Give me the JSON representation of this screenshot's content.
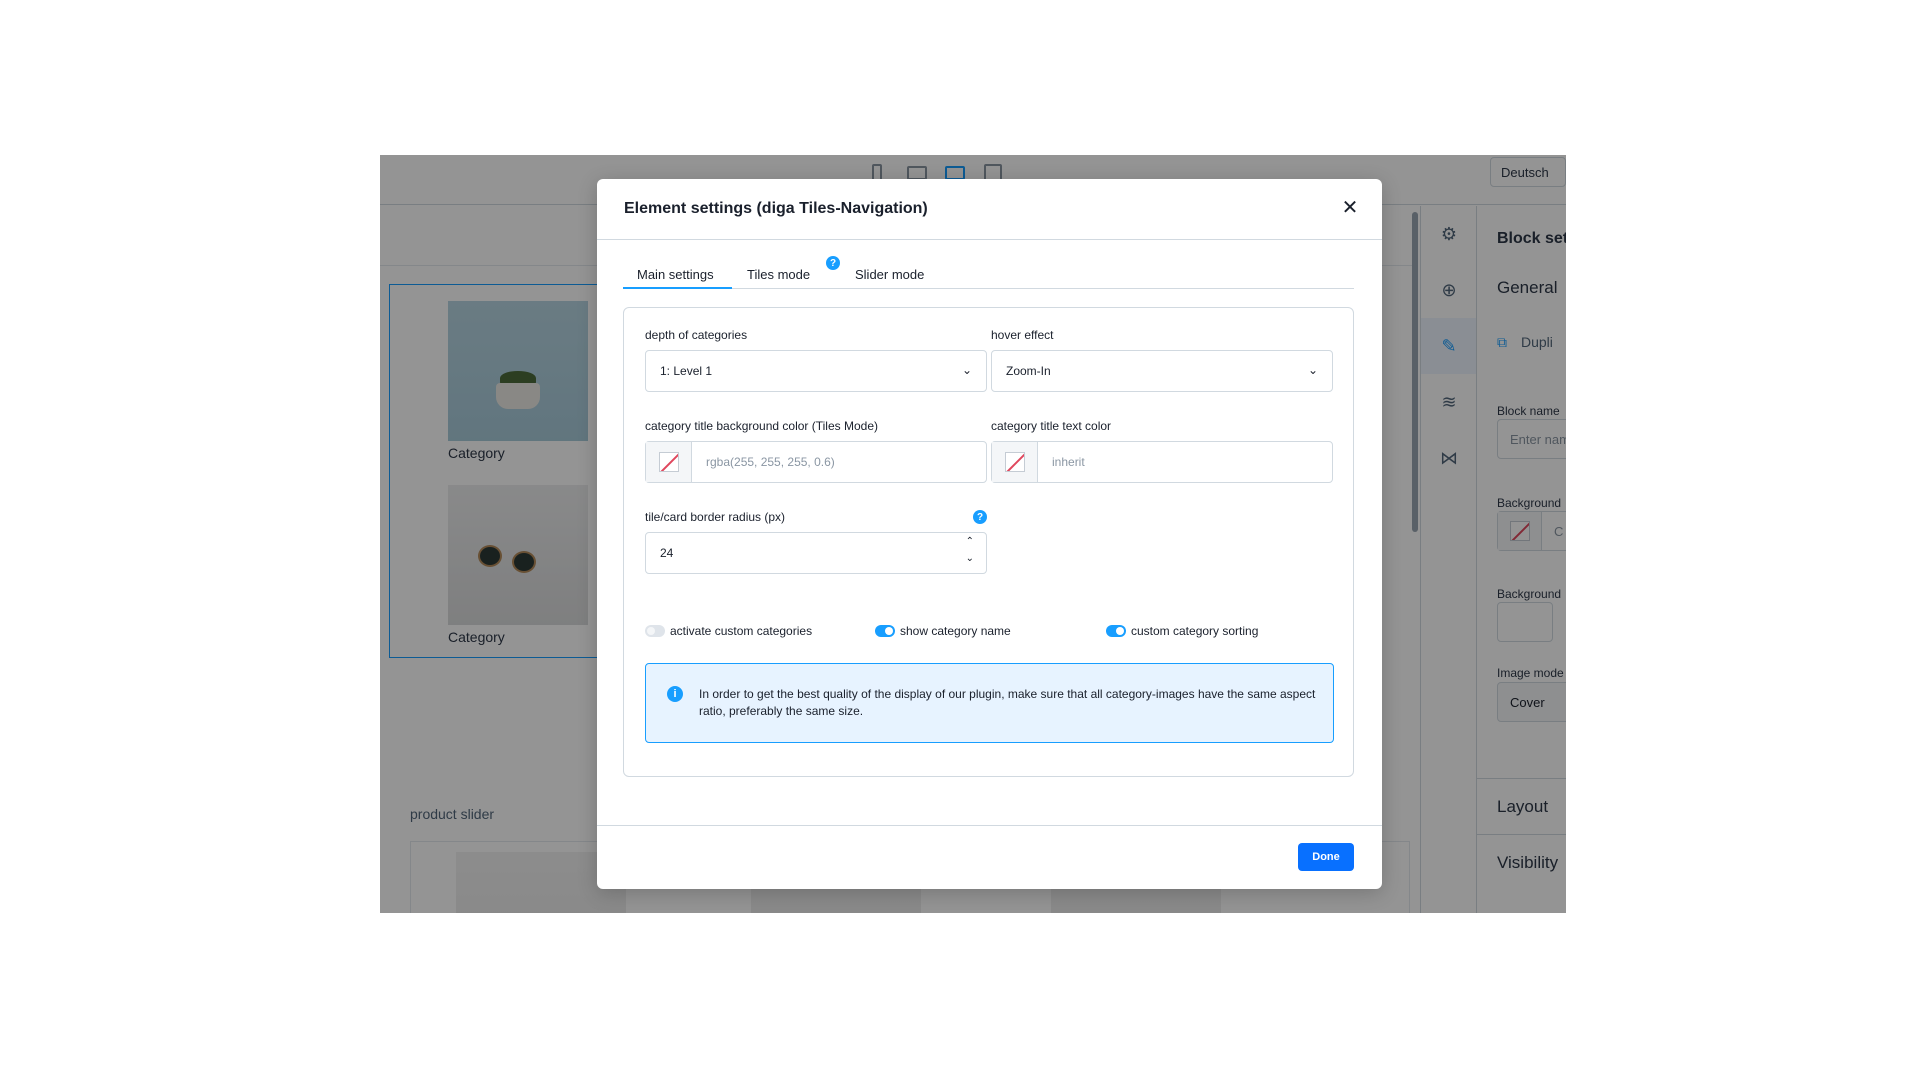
{
  "background": {
    "language_select": "Deutsch",
    "tiles": [
      {
        "label": "Category",
        "image_icon": "plant-image"
      },
      {
        "label": "Category",
        "image_icon": "sunglasses-image"
      }
    ],
    "product_slider_label": "product slider",
    "sidebar_nav": [
      "gear-icon",
      "plus-circle-icon",
      "edit-icon",
      "layers-icon",
      "share-icon"
    ],
    "sidebar_panel": {
      "title": "Block set",
      "general": "General",
      "duplicate": "Dupli",
      "block_name_label": "Block name",
      "block_name_placeholder": "Enter nam",
      "background_label": "Background",
      "background_value": "C",
      "background_image_label": "Background",
      "image_mode_label": "Image mode",
      "image_mode_value": "Cover",
      "layout": "Layout",
      "visibility": "Visibility"
    }
  },
  "modal": {
    "title": "Element settings (diga Tiles-Navigation)",
    "tabs": [
      "Main settings",
      "Tiles mode",
      "Slider mode"
    ],
    "tiles_mode_help": "?",
    "fields": {
      "depth_label": "depth of categories",
      "depth_value": "1: Level 1",
      "hover_label": "hover effect",
      "hover_value": "Zoom-In",
      "bg_color_label": "category title background color (Tiles Mode)",
      "bg_color_placeholder": "rgba(255, 255, 255, 0.6)",
      "text_color_label": "category title text color",
      "text_color_placeholder": "inherit",
      "radius_label": "tile/card border radius (px)",
      "radius_value": "24",
      "radius_help": "?"
    },
    "toggles": [
      {
        "label": "activate custom categories",
        "on": false
      },
      {
        "label": "show category name",
        "on": true
      },
      {
        "label": "custom category sorting",
        "on": true
      }
    ],
    "info": "In order to get the best quality of the display of our plugin, make sure that all category-images have the same aspect ratio, preferably the same size.",
    "info_icon": "i",
    "done_label": "Done"
  },
  "colors": {
    "accent": "#189eff",
    "primary_button": "#0870ff",
    "overlay": "rgba(0,0,0,0.42)"
  }
}
